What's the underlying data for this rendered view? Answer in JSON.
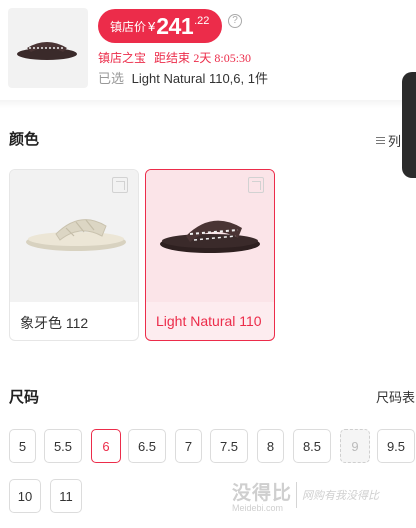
{
  "header": {
    "price_label": "镇店价",
    "currency": "¥",
    "price_int": "241",
    "price_dec": ".22",
    "help_glyph": "?",
    "promo_badge": "镇店之宝",
    "promo_countdown_label": "距结束",
    "promo_countdown": "2天 8:05:30",
    "selected_prefix": "已选",
    "selected_value": "Light Natural 110,6, 1件"
  },
  "color_section": {
    "title": "颜色",
    "list_toggle_label": "列",
    "options": [
      {
        "name": "象牙色 112",
        "selected": false,
        "swatch": "#e8e2d2",
        "strap": "#dcd6c4"
      },
      {
        "name": "Light Natural 110",
        "selected": true,
        "swatch": "#3a2a2a",
        "strap": "#4a3434"
      }
    ]
  },
  "size_section": {
    "title": "尺码",
    "chart_link": "尺码表",
    "sizes": [
      {
        "label": "5",
        "state": "normal"
      },
      {
        "label": "5.5",
        "state": "normal"
      },
      {
        "label": "6",
        "state": "selected"
      },
      {
        "label": "6.5",
        "state": "normal"
      },
      {
        "label": "7",
        "state": "normal"
      },
      {
        "label": "7.5",
        "state": "normal"
      },
      {
        "label": "8",
        "state": "normal"
      },
      {
        "label": "8.5",
        "state": "normal"
      },
      {
        "label": "9",
        "state": "disabled"
      },
      {
        "label": "9.5",
        "state": "normal"
      },
      {
        "label": "10",
        "state": "normal"
      },
      {
        "label": "11",
        "state": "normal"
      }
    ]
  },
  "watermark": {
    "brand": "没得比",
    "domain": "Meidebi.com",
    "slogan": "网购有我没得比"
  },
  "colors": {
    "accent": "#ec2c4a",
    "selected_bg": "#fdecef",
    "border": "#dcdcdc"
  }
}
